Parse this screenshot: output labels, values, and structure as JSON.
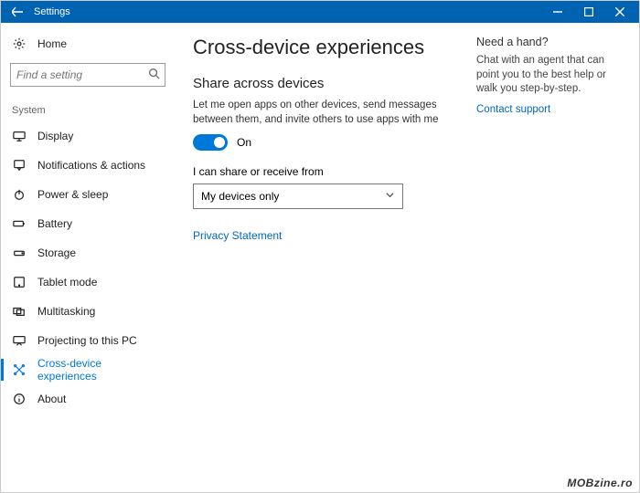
{
  "titlebar": {
    "title": "Settings"
  },
  "sidebar": {
    "home_label": "Home",
    "search_placeholder": "Find a setting",
    "group_label": "System",
    "items": [
      {
        "label": "Display"
      },
      {
        "label": "Notifications & actions"
      },
      {
        "label": "Power & sleep"
      },
      {
        "label": "Battery"
      },
      {
        "label": "Storage"
      },
      {
        "label": "Tablet mode"
      },
      {
        "label": "Multitasking"
      },
      {
        "label": "Projecting to this PC"
      },
      {
        "label": "Cross-device experiences"
      },
      {
        "label": "About"
      }
    ]
  },
  "main": {
    "heading": "Cross-device experiences",
    "section_title": "Share across devices",
    "description": "Let me open apps on other devices, send messages between them, and invite others to use apps with me",
    "toggle_state": "On",
    "share_label": "I can share or receive from",
    "share_value": "My devices only",
    "privacy_link": "Privacy Statement"
  },
  "aside": {
    "title": "Need a hand?",
    "body": "Chat with an agent that can point you to the best help or walk you step-by-step.",
    "link": "Contact support"
  },
  "watermark": "MOBzine.ro"
}
